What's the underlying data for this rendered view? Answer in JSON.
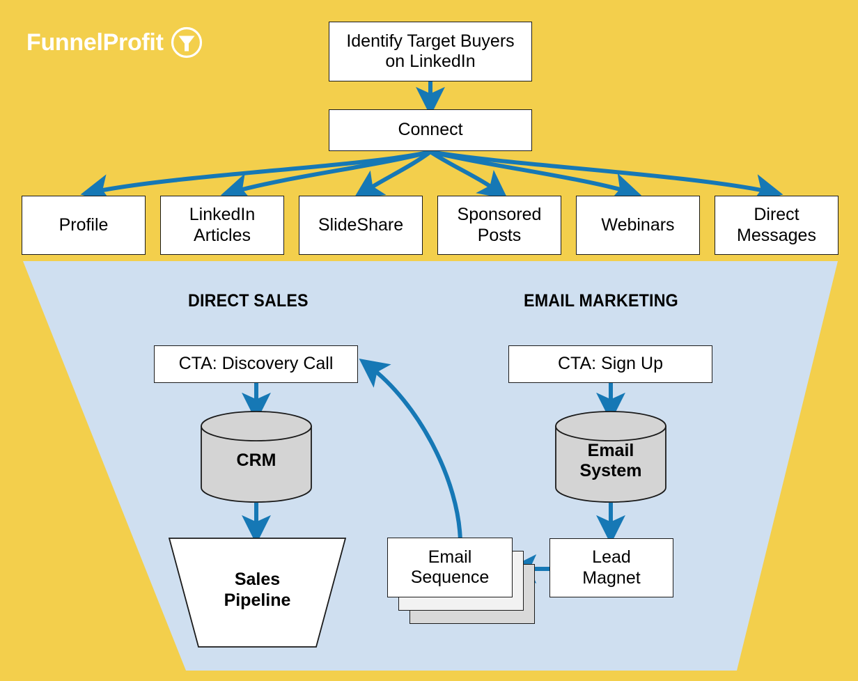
{
  "brand": {
    "name": "FunnelProfit",
    "logo_icon": "funnel-in-circle-icon",
    "logo_color": "#ffffff"
  },
  "colors": {
    "background_yellow": "#f3cf4c",
    "funnel_blue": "#cfdff0",
    "arrow_blue": "#1678b5",
    "node_fill": "#ffffff",
    "node_stroke": "#1a1a1a",
    "cylinder_fill": "#d4d4d4",
    "stack_back_fill": "#d9d9d9",
    "stack_mid_fill": "#f2f2f2"
  },
  "top_flow": {
    "start": "Identify Target Buyers\non LinkedIn",
    "start_line1": "Identify Target Buyers",
    "start_line2": "on LinkedIn",
    "connect": "Connect"
  },
  "channels": [
    {
      "label": "Profile",
      "line1": "Profile",
      "line2": ""
    },
    {
      "label": "LinkedIn Articles",
      "line1": "LinkedIn",
      "line2": "Articles"
    },
    {
      "label": "SlideShare",
      "line1": "SlideShare",
      "line2": ""
    },
    {
      "label": "Sponsored Posts",
      "line1": "Sponsored",
      "line2": "Posts"
    },
    {
      "label": "Webinars",
      "line1": "Webinars",
      "line2": ""
    },
    {
      "label": "Direct Messages",
      "line1": "Direct",
      "line2": "Messages"
    }
  ],
  "sections": [
    {
      "id": "direct-sales",
      "title": "DIRECT SALES"
    },
    {
      "id": "email-marketing",
      "title": "EMAIL MARKETING"
    }
  ],
  "direct_sales": {
    "cta": "CTA: Discovery Call",
    "database": "CRM",
    "outcome_line1": "Sales",
    "outcome_line2": "Pipeline",
    "outcome": "Sales Pipeline"
  },
  "email_marketing": {
    "cta": "CTA: Sign Up",
    "database_line1": "Email",
    "database_line2": "System",
    "database": "Email System",
    "asset_line1": "Lead",
    "asset_line2": "Magnet",
    "asset": "Lead Magnet",
    "sequence_line1": "Email",
    "sequence_line2": "Sequence",
    "sequence": "Email Sequence"
  }
}
